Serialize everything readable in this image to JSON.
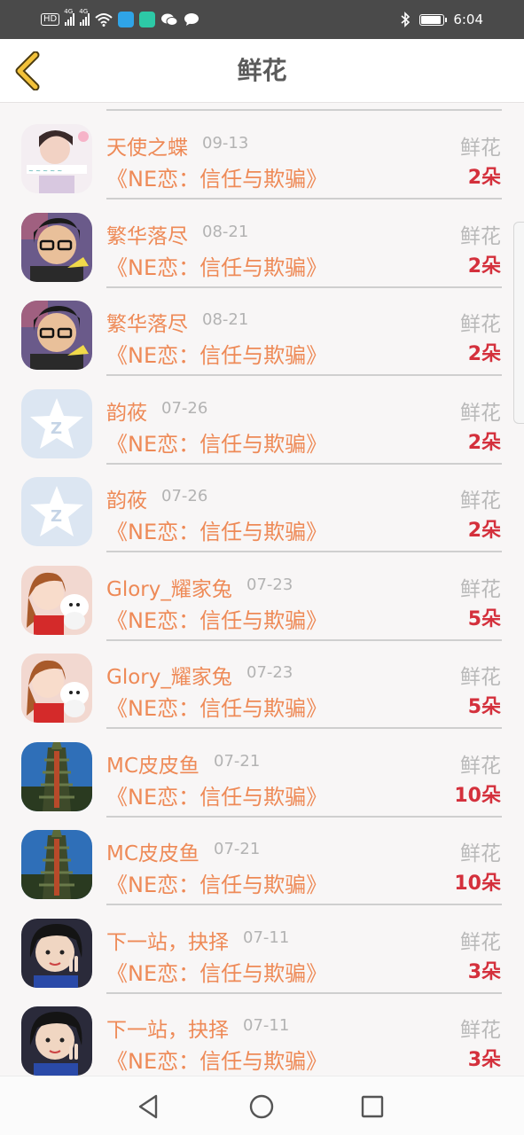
{
  "status_bar": {
    "hd": "HD",
    "sim1": "4G",
    "sim2": "4G",
    "time": "6:04",
    "battery_level": 0.9,
    "icons": [
      "hd-icon",
      "signal-icon",
      "signal-icon",
      "wifi-icon",
      "qq-icon",
      "app-icon",
      "wechat-icon",
      "message-icon",
      "bluetooth-icon",
      "battery-icon"
    ]
  },
  "header": {
    "title": "鲜花",
    "back_icon": "chevron-left-icon"
  },
  "list": {
    "items": [
      {
        "name": "天使之蝶",
        "date": "09-13",
        "gift": "鲜花",
        "book": "《NE恋：信任与欺骗》",
        "count": "2朵",
        "avatar": "girl-photo"
      },
      {
        "name": "繁华落尽",
        "date": "08-21",
        "gift": "鲜花",
        "book": "《NE恋：信任与欺骗》",
        "count": "2朵",
        "avatar": "glasses-photo"
      },
      {
        "name": "繁华落尽",
        "date": "08-21",
        "gift": "鲜花",
        "book": "《NE恋：信任与欺骗》",
        "count": "2朵",
        "avatar": "glasses-photo"
      },
      {
        "name": "韵莜",
        "date": "07-26",
        "gift": "鲜花",
        "book": "《NE恋：信任与欺骗》",
        "count": "2朵",
        "avatar": "default-star"
      },
      {
        "name": "韵莜",
        "date": "07-26",
        "gift": "鲜花",
        "book": "《NE恋：信任与欺骗》",
        "count": "2朵",
        "avatar": "default-star"
      },
      {
        "name": "Glory_耀家兔",
        "date": "07-23",
        "gift": "鲜花",
        "book": "《NE恋：信任与欺骗》",
        "count": "5朵",
        "avatar": "cartoon-girl"
      },
      {
        "name": "Glory_耀家兔",
        "date": "07-23",
        "gift": "鲜花",
        "book": "《NE恋：信任与欺骗》",
        "count": "5朵",
        "avatar": "cartoon-girl"
      },
      {
        "name": "MC皮皮鱼",
        "date": "07-21",
        "gift": "鲜花",
        "book": "《NE恋：信任与欺骗》",
        "count": "10朵",
        "avatar": "tower-photo"
      },
      {
        "name": "MC皮皮鱼",
        "date": "07-21",
        "gift": "鲜花",
        "book": "《NE恋：信任与欺骗》",
        "count": "10朵",
        "avatar": "tower-photo"
      },
      {
        "name": "下一站，抉择",
        "date": "07-11",
        "gift": "鲜花",
        "book": "《NE恋：信任与欺骗》",
        "count": "3朵",
        "avatar": "peace-girl"
      },
      {
        "name": "下一站，抉择",
        "date": "07-11",
        "gift": "鲜花",
        "book": "《NE恋：信任与欺骗》",
        "count": "3朵",
        "avatar": "peace-girl"
      }
    ]
  },
  "colors": {
    "name": "#ee8a57",
    "count": "#d4303c",
    "muted": "#b9b9b9",
    "accent_back": "#f3c23a"
  },
  "nav": {
    "back": "triangle-back-icon",
    "home": "circle-home-icon",
    "recents": "square-recents-icon"
  }
}
